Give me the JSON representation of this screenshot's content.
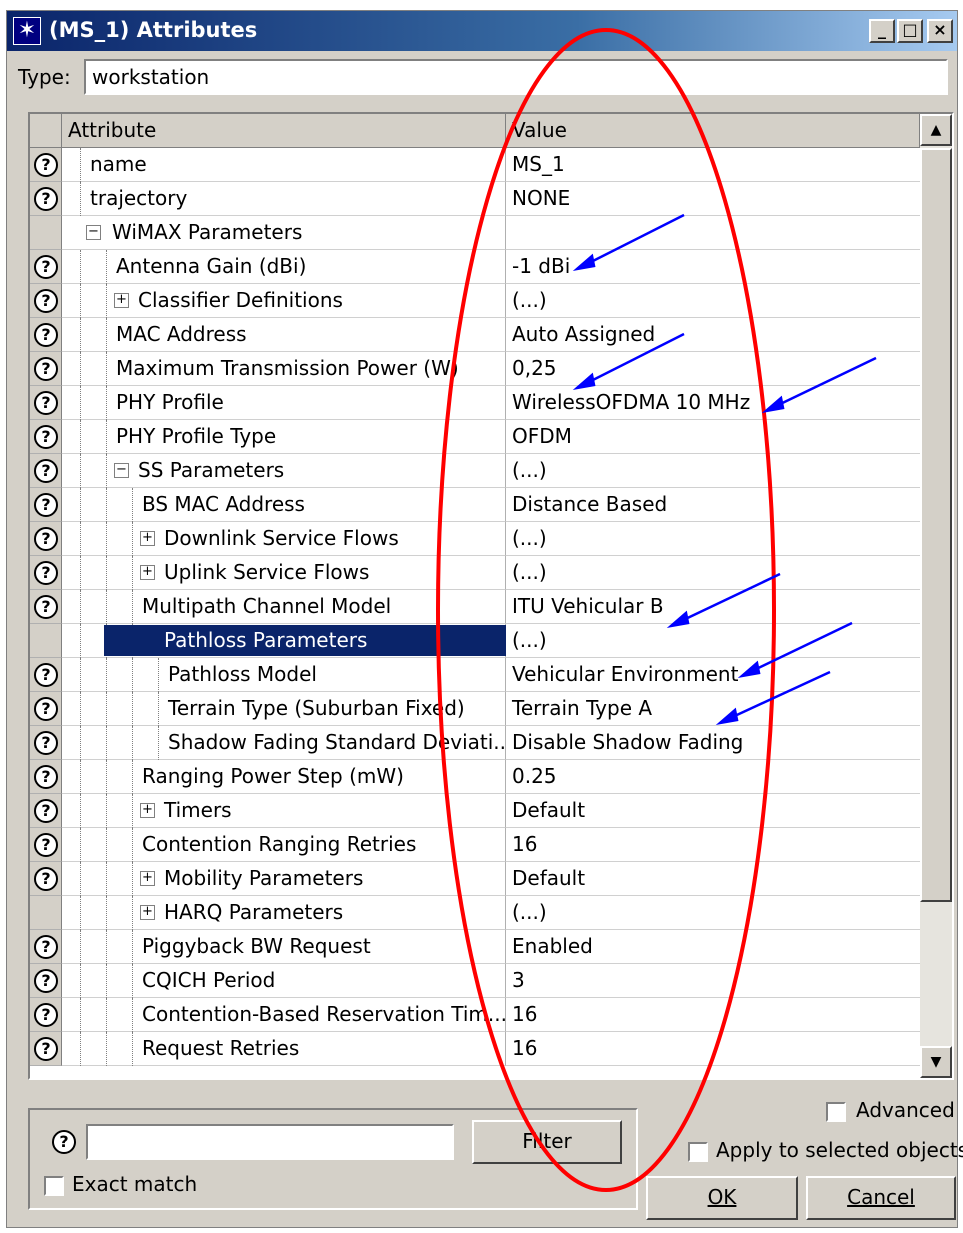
{
  "window": {
    "title": "(MS_1) Attributes",
    "controls": {
      "minimize": "_",
      "maximize": "□",
      "close": "×"
    }
  },
  "type_field": {
    "label": "Type:",
    "value": "workstation"
  },
  "grid": {
    "columns": {
      "attribute": "Attribute",
      "value": "Value"
    },
    "rows": [
      {
        "attr": "name",
        "value": "MS_1",
        "help": true,
        "indent": 0,
        "expander": "",
        "selected": false
      },
      {
        "attr": "trajectory",
        "value": "NONE",
        "help": true,
        "indent": 0,
        "expander": "",
        "selected": false
      },
      {
        "attr": "WiMAX Parameters",
        "value": "",
        "help": false,
        "indent": 0,
        "expander": "minus",
        "selected": false
      },
      {
        "attr": "Antenna Gain (dBi)",
        "value": "-1 dBi",
        "help": true,
        "indent": 1,
        "expander": "",
        "selected": false
      },
      {
        "attr": "Classifier Definitions",
        "value": "(...)",
        "help": true,
        "indent": 1,
        "expander": "plus",
        "selected": false
      },
      {
        "attr": "MAC Address",
        "value": "Auto Assigned",
        "help": true,
        "indent": 1,
        "expander": "",
        "selected": false
      },
      {
        "attr": "Maximum Transmission Power (W)",
        "value": "0,25",
        "help": true,
        "indent": 1,
        "expander": "",
        "selected": false
      },
      {
        "attr": "PHY Profile",
        "value": "WirelessOFDMA 10 MHz",
        "help": true,
        "indent": 1,
        "expander": "",
        "selected": false
      },
      {
        "attr": "PHY Profile Type",
        "value": "OFDM",
        "help": true,
        "indent": 1,
        "expander": "",
        "selected": false
      },
      {
        "attr": "SS Parameters",
        "value": "(...)",
        "help": true,
        "indent": 1,
        "expander": "minus",
        "selected": false
      },
      {
        "attr": "BS MAC Address",
        "value": "Distance Based",
        "help": true,
        "indent": 2,
        "expander": "",
        "selected": false
      },
      {
        "attr": "Downlink Service Flows",
        "value": "(...)",
        "help": true,
        "indent": 2,
        "expander": "plus",
        "selected": false
      },
      {
        "attr": "Uplink Service Flows",
        "value": "(...)",
        "help": true,
        "indent": 2,
        "expander": "plus",
        "selected": false
      },
      {
        "attr": "Multipath Channel Model",
        "value": "ITU Vehicular B",
        "help": true,
        "indent": 2,
        "expander": "",
        "selected": false
      },
      {
        "attr": "Pathloss Parameters",
        "value": "(...)",
        "help": false,
        "indent": 2,
        "expander": "minus",
        "selected": true
      },
      {
        "attr": "Pathloss Model",
        "value": "Vehicular Environment",
        "help": true,
        "indent": 3,
        "expander": "",
        "selected": false
      },
      {
        "attr": "Terrain Type (Suburban Fixed)",
        "value": "Terrain Type A",
        "help": true,
        "indent": 3,
        "expander": "",
        "selected": false
      },
      {
        "attr": "Shadow Fading Standard Deviati...",
        "value": "Disable Shadow Fading",
        "help": true,
        "indent": 3,
        "expander": "",
        "selected": false
      },
      {
        "attr": "Ranging Power Step (mW)",
        "value": "0.25",
        "help": true,
        "indent": 2,
        "expander": "",
        "selected": false
      },
      {
        "attr": "Timers",
        "value": "Default",
        "help": true,
        "indent": 2,
        "expander": "plus",
        "selected": false
      },
      {
        "attr": "Contention Ranging Retries",
        "value": "16",
        "help": true,
        "indent": 2,
        "expander": "",
        "selected": false
      },
      {
        "attr": "Mobility Parameters",
        "value": "Default",
        "help": true,
        "indent": 2,
        "expander": "plus",
        "selected": false
      },
      {
        "attr": "HARQ Parameters",
        "value": "(...)",
        "help": false,
        "indent": 2,
        "expander": "plus",
        "selected": false
      },
      {
        "attr": "Piggyback BW Request",
        "value": "Enabled",
        "help": true,
        "indent": 2,
        "expander": "",
        "selected": false
      },
      {
        "attr": "CQICH Period",
        "value": "3",
        "help": true,
        "indent": 2,
        "expander": "",
        "selected": false
      },
      {
        "attr": "Contention-Based Reservation Tim...",
        "value": "16",
        "help": true,
        "indent": 2,
        "expander": "",
        "selected": false
      },
      {
        "attr": "Request Retries",
        "value": "16",
        "help": true,
        "indent": 2,
        "expander": "",
        "selected": false
      }
    ]
  },
  "filter": {
    "value": "",
    "button_label": "Filter",
    "exact_match_label": "Exact match",
    "exact_match_checked": false
  },
  "options": {
    "advanced_label": "Advanced",
    "advanced_checked": false,
    "apply_selected_label": "Apply to selected objects",
    "apply_selected_checked": false
  },
  "buttons": {
    "ok": "OK",
    "cancel": "Cancel"
  },
  "icons": {
    "help": "question-mark-icon",
    "app": "star-icon",
    "expand": "plus-box-icon",
    "collapse": "minus-box-icon",
    "scroll_up": "arrow-up-icon",
    "scroll_down": "arrow-down-icon"
  },
  "colors": {
    "titlebar_start": "#0a246a",
    "titlebar_end": "#a6caf0",
    "face": "#d4d0c8",
    "selection": "#0a246a",
    "annotation_ellipse": "#ff0000",
    "annotation_arrows": "#0000ff"
  }
}
